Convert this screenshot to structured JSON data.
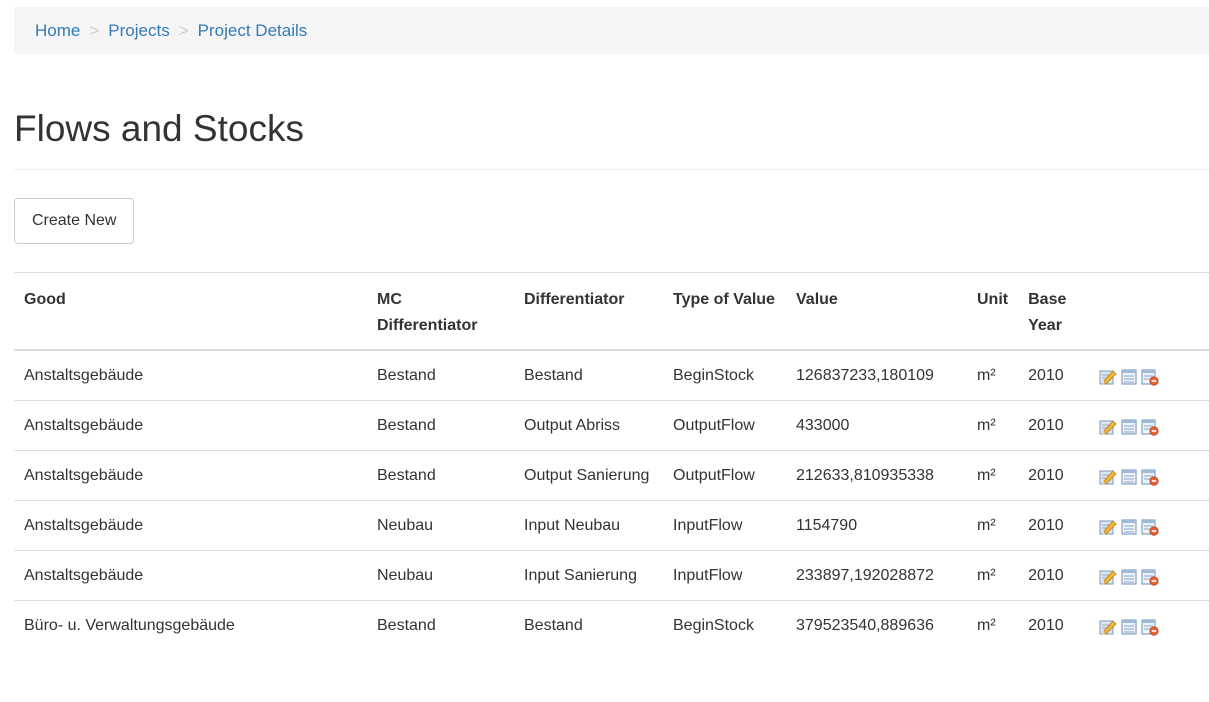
{
  "breadcrumb": {
    "items": [
      "Home",
      "Projects",
      "Project Details"
    ],
    "separator": ">"
  },
  "page": {
    "title": "Flows and Stocks"
  },
  "toolbar": {
    "create_label": "Create New"
  },
  "table": {
    "headers": {
      "good": "Good",
      "mc_diff": "MC Differentiator",
      "diff": "Differentiator",
      "type": "Type of Value",
      "value": "Value",
      "unit": "Unit",
      "base_year": "Base Year"
    },
    "rows": [
      {
        "good": "Anstaltsgebäude",
        "mc": "Bestand",
        "diff": "Bestand",
        "type": "BeginStock",
        "value": "126837233,180109",
        "unit": "m²",
        "year": "2010"
      },
      {
        "good": "Anstaltsgebäude",
        "mc": "Bestand",
        "diff": "Output Abriss",
        "type": "OutputFlow",
        "value": "433000",
        "unit": "m²",
        "year": "2010"
      },
      {
        "good": "Anstaltsgebäude",
        "mc": "Bestand",
        "diff": "Output Sanierung",
        "type": "OutputFlow",
        "value": "212633,810935338",
        "unit": "m²",
        "year": "2010"
      },
      {
        "good": "Anstaltsgebäude",
        "mc": "Neubau",
        "diff": "Input Neubau",
        "type": "InputFlow",
        "value": "1154790",
        "unit": "m²",
        "year": "2010"
      },
      {
        "good": "Anstaltsgebäude",
        "mc": "Neubau",
        "diff": "Input Sanierung",
        "type": "InputFlow",
        "value": "233897,192028872",
        "unit": "m²",
        "year": "2010"
      },
      {
        "good": "Büro- u. Verwaltungsgebäude",
        "mc": "Bestand",
        "diff": "Bestand",
        "type": "BeginStock",
        "value": "379523540,889636",
        "unit": "m²",
        "year": "2010"
      }
    ],
    "action_icons": [
      "edit-icon",
      "details-icon",
      "delete-icon"
    ]
  },
  "colors": {
    "link": "#337ab7",
    "breadcrumb_bg": "#f5f5f5",
    "border": "#dddddd"
  }
}
